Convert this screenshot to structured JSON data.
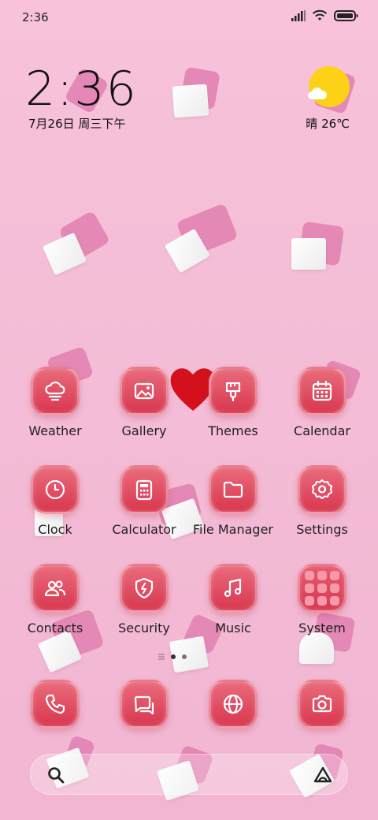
{
  "status_bar": {
    "time": "2:36",
    "icons": [
      "signal-icon",
      "wifi-icon",
      "battery-icon"
    ]
  },
  "clock_widget": {
    "time": "2:36",
    "date": "7月26日 周三下午"
  },
  "weather_widget": {
    "text": "晴 26℃",
    "icon": "sunny-cloud-icon"
  },
  "apps": [
    {
      "label": "Weather",
      "icon": "cloud-icon"
    },
    {
      "label": "Gallery",
      "icon": "image-icon"
    },
    {
      "label": "Themes",
      "icon": "brush-icon"
    },
    {
      "label": "Calendar",
      "icon": "calendar-icon"
    },
    {
      "label": "Clock",
      "icon": "clock-icon"
    },
    {
      "label": "Calculator",
      "icon": "calculator-icon"
    },
    {
      "label": "File Manager",
      "icon": "folder-icon"
    },
    {
      "label": "Settings",
      "icon": "gear-icon"
    },
    {
      "label": "Contacts",
      "icon": "contacts-icon"
    },
    {
      "label": "Security",
      "icon": "shield-icon"
    },
    {
      "label": "Music",
      "icon": "music-icon"
    },
    {
      "label": "System",
      "icon": "app-grid-icon"
    }
  ],
  "dock": [
    {
      "icon": "phone-icon"
    },
    {
      "icon": "messages-icon"
    },
    {
      "icon": "browser-icon"
    },
    {
      "icon": "camera-icon"
    }
  ],
  "page_indicator": {
    "pages": 2,
    "current": 1
  },
  "search_bar": {
    "left_icon": "search-icon",
    "right_icon": "assistant-icon"
  },
  "colors": {
    "wallpaper": "#f4bcd6",
    "icon_tile": "#d8374f",
    "sun": "#fcd116"
  }
}
